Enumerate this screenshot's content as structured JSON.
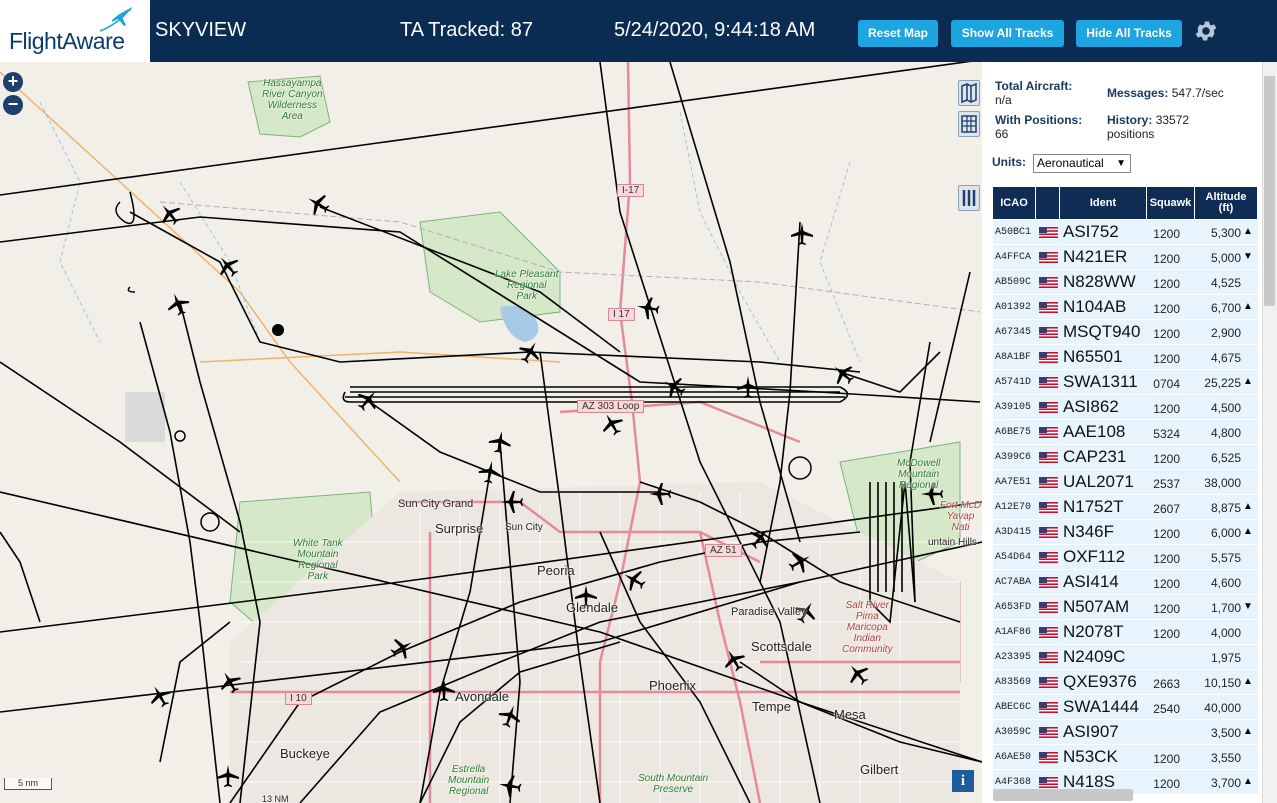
{
  "header": {
    "logo_text": "FlightAware",
    "app_title": "SKYVIEW",
    "ta_tracked": "TA Tracked: 87",
    "clock": "5/24/2020, 9:44:18 AM",
    "buttons": {
      "reset": "Reset Map",
      "show_all": "Show All Tracks",
      "hide_all": "Hide All Tracks"
    },
    "settings_icon": "gear-icon"
  },
  "map": {
    "zoom_in": "+",
    "zoom_out": "−",
    "info": "i",
    "scale": "5 nm",
    "places": {
      "surprise": "Surprise",
      "sun_city_grand": "Sun City Grand",
      "sun_city": "Sun City",
      "peoria": "Peoria",
      "glendale": "Glendale",
      "phoenix": "Phoenix",
      "scottsdale": "Scottsdale",
      "paradise_valley": "Paradise Valley",
      "tempe": "Tempe",
      "mesa": "Mesa",
      "gilbert": "Gilbert",
      "avondale": "Avondale",
      "buckeye": "Buckeye",
      "fountain_hills": "untain Hills"
    },
    "parks": {
      "hassayampa": "Hassayampa\nRiver Canyon\nWilderness\nArea",
      "lake_pleasant": "Lake Pleasant\nRegional\nPark",
      "white_tank": "White Tank\nMountain\nRegional\nPark",
      "mcdowell": "McDowell\nMountain\nRegional",
      "salt_river": "Salt River\nPima\nMaricopa\nIndian\nCommunity",
      "estrella": "Estrella\nMountain\nRegional",
      "south_mountain": "South Mountain\nPreserve",
      "fort_mcdowell": "Fort McD\nYavap\nNati"
    },
    "roads": {
      "i17_north": "I-17",
      "i17": "I 17",
      "az303": "AZ 303 Loop",
      "az51": "AZ 51",
      "i10": "I 10"
    },
    "bottom_label": "13 NM"
  },
  "sidebar": {
    "total_aircraft_label": "Total Aircraft:",
    "total_aircraft_value": "n/a",
    "messages_label": "Messages:",
    "messages_value": "547.7/sec",
    "with_positions_label": "With Positions:",
    "with_positions_value": "66",
    "history_label": "History:",
    "history_value": "33572 positions",
    "units_label": "Units:",
    "units_value": "Aeronautical",
    "columns": {
      "icao": "ICAO",
      "ident": "Ident",
      "squawk": "Squawk",
      "altitude": "Altitude (ft)"
    },
    "rows": [
      {
        "icao": "A50BC1",
        "ident": "ASI752",
        "squawk": "1200",
        "alt": "5,300",
        "trend": "▲"
      },
      {
        "icao": "A4FFCA",
        "ident": "N421ER",
        "squawk": "1200",
        "alt": "5,000",
        "trend": "▼"
      },
      {
        "icao": "AB509C",
        "ident": "N828WW",
        "squawk": "1200",
        "alt": "4,525",
        "trend": ""
      },
      {
        "icao": "A01392",
        "ident": "N104AB",
        "squawk": "1200",
        "alt": "6,700",
        "trend": "▲"
      },
      {
        "icao": "A67345",
        "ident": "MSQT940",
        "squawk": "1200",
        "alt": "2,900",
        "trend": ""
      },
      {
        "icao": "A8A1BF",
        "ident": "N65501",
        "squawk": "1200",
        "alt": "4,675",
        "trend": ""
      },
      {
        "icao": "A5741D",
        "ident": "SWA1311",
        "squawk": "0704",
        "alt": "25,225",
        "trend": "▲"
      },
      {
        "icao": "A39105",
        "ident": "ASI862",
        "squawk": "1200",
        "alt": "4,500",
        "trend": ""
      },
      {
        "icao": "A6BE75",
        "ident": "AAE108",
        "squawk": "5324",
        "alt": "4,800",
        "trend": ""
      },
      {
        "icao": "A399C6",
        "ident": "CAP231",
        "squawk": "1200",
        "alt": "6,525",
        "trend": ""
      },
      {
        "icao": "AA7E51",
        "ident": "UAL2071",
        "squawk": "2537",
        "alt": "38,000",
        "trend": ""
      },
      {
        "icao": "A12E70",
        "ident": "N1752T",
        "squawk": "2607",
        "alt": "8,875",
        "trend": "▲"
      },
      {
        "icao": "A3D415",
        "ident": "N346F",
        "squawk": "1200",
        "alt": "6,000",
        "trend": "▲"
      },
      {
        "icao": "A54D64",
        "ident": "OXF112",
        "squawk": "1200",
        "alt": "5,575",
        "trend": ""
      },
      {
        "icao": "AC7ABA",
        "ident": "ASI414",
        "squawk": "1200",
        "alt": "4,600",
        "trend": ""
      },
      {
        "icao": "A653FD",
        "ident": "N507AM",
        "squawk": "1200",
        "alt": "1,700",
        "trend": "▼"
      },
      {
        "icao": "A1AF86",
        "ident": "N2078T",
        "squawk": "1200",
        "alt": "4,000",
        "trend": ""
      },
      {
        "icao": "A23395",
        "ident": "N2409C",
        "squawk": "",
        "alt": "1,975",
        "trend": ""
      },
      {
        "icao": "A83569",
        "ident": "QXE9376",
        "squawk": "2663",
        "alt": "10,150",
        "trend": "▲"
      },
      {
        "icao": "ABEC6C",
        "ident": "SWA1444",
        "squawk": "2540",
        "alt": "40,000",
        "trend": ""
      },
      {
        "icao": "A3059C",
        "ident": "ASI907",
        "squawk": "",
        "alt": "3,500",
        "trend": "▲"
      },
      {
        "icao": "A6AE50",
        "ident": "N53CK",
        "squawk": "1200",
        "alt": "3,550",
        "trend": ""
      },
      {
        "icao": "A4F368",
        "ident": "N418S",
        "squawk": "1200",
        "alt": "3,700",
        "trend": "▲"
      }
    ]
  }
}
